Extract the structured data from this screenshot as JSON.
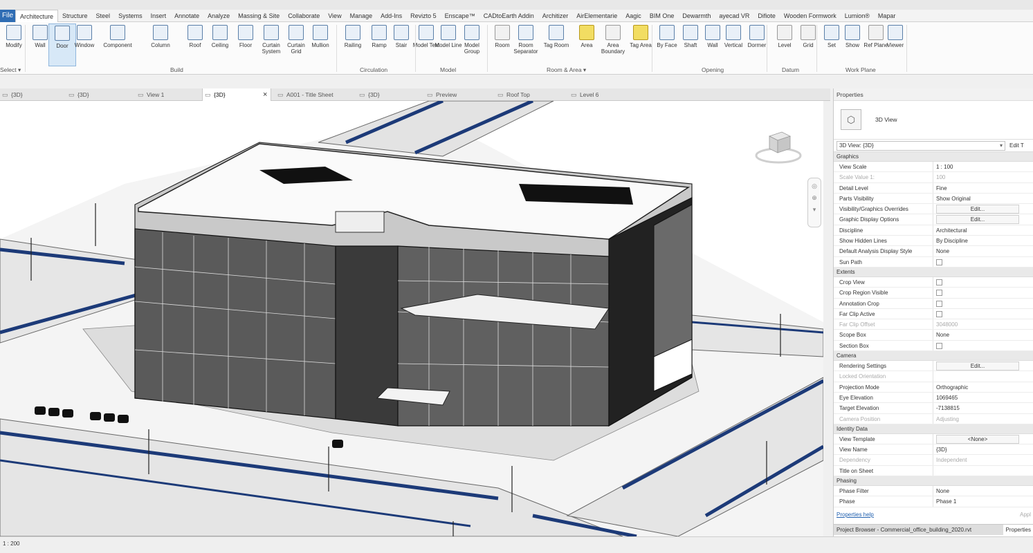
{
  "menu": {
    "file_label": "File",
    "tabs": [
      "Architecture",
      "Structure",
      "Steel",
      "Systems",
      "Insert",
      "Annotate",
      "Analyze",
      "Massing & Site",
      "Collaborate",
      "View",
      "Manage",
      "Add-Ins",
      "Revizto 5",
      "Enscape™",
      "CADtoEarth Addin",
      "Architizer",
      "AirElementarie",
      "Aagic",
      "BIM One",
      "Dewarmth",
      "ayecad VR",
      "Difiote",
      "Wooden Formwork",
      "Lumion®",
      "Mapar"
    ],
    "active_tab": "Architecture"
  },
  "ribbon": {
    "tools": [
      {
        "label": "Modify",
        "icon": "cursor-icon"
      },
      {
        "label": "Wall",
        "icon": "wall-icon"
      },
      {
        "label": "Door",
        "icon": "door-icon"
      },
      {
        "label": "Window",
        "icon": "window-icon"
      },
      {
        "label": "Component",
        "icon": "component-icon"
      },
      {
        "label": "Column",
        "icon": "column-icon"
      },
      {
        "label": "Roof",
        "icon": "roof-icon"
      },
      {
        "label": "Ceiling",
        "icon": "ceiling-icon"
      },
      {
        "label": "Floor",
        "icon": "floor-icon"
      },
      {
        "label": "Curtain System",
        "icon": "curtain-system-icon"
      },
      {
        "label": "Curtain Grid",
        "icon": "curtain-grid-icon"
      },
      {
        "label": "Mullion",
        "icon": "mullion-icon"
      },
      {
        "label": "Railing",
        "icon": "railing-icon"
      },
      {
        "label": "Ramp",
        "icon": "ramp-icon"
      },
      {
        "label": "Stair",
        "icon": "stair-icon"
      },
      {
        "label": "Model Text",
        "icon": "model-text-icon"
      },
      {
        "label": "Model Line",
        "icon": "model-line-icon"
      },
      {
        "label": "Model Group",
        "icon": "model-group-icon"
      },
      {
        "label": "Room",
        "icon": "room-icon"
      },
      {
        "label": "Room Separator",
        "icon": "room-separator-icon"
      },
      {
        "label": "Tag Room",
        "icon": "tag-room-icon"
      },
      {
        "label": "Area",
        "icon": "area-icon"
      },
      {
        "label": "Area Boundary",
        "icon": "area-boundary-icon"
      },
      {
        "label": "Tag Area",
        "icon": "tag-area-icon"
      },
      {
        "label": "By Face",
        "icon": "by-face-icon"
      },
      {
        "label": "Shaft",
        "icon": "shaft-icon"
      },
      {
        "label": "Wall",
        "icon": "wall-opening-icon"
      },
      {
        "label": "Vertical",
        "icon": "vertical-icon"
      },
      {
        "label": "Dormer",
        "icon": "dormer-icon"
      },
      {
        "label": "Level",
        "icon": "level-icon"
      },
      {
        "label": "Grid",
        "icon": "grid-icon"
      },
      {
        "label": "Set",
        "icon": "set-icon"
      },
      {
        "label": "Show",
        "icon": "show-icon"
      },
      {
        "label": "Ref Plane",
        "icon": "ref-plane-icon"
      },
      {
        "label": "Viewer",
        "icon": "viewer-icon"
      }
    ],
    "panels": [
      "Select ▾",
      "Build",
      "Circulation",
      "Model",
      "Room & Area ▾",
      "Opening",
      "Datum",
      "Work Plane"
    ]
  },
  "view_tabs": [
    {
      "label": "{3D}",
      "active": false
    },
    {
      "label": "{3D}",
      "active": false
    },
    {
      "label": "View 1",
      "active": false
    },
    {
      "label": "{3D}",
      "active": true
    },
    {
      "label": "A001 - Title Sheet",
      "active": false
    },
    {
      "label": "{3D}",
      "active": false
    },
    {
      "label": "Preview",
      "active": false
    },
    {
      "label": "Roof Top",
      "active": false
    },
    {
      "label": "Level 6",
      "active": false
    }
  ],
  "properties": {
    "title": "Properties",
    "type_name": "3D View",
    "selector": "3D View: {3D}",
    "edit_type": "Edit T",
    "groups": [
      {
        "name": "Graphics",
        "rows": [
          {
            "name": "View Scale",
            "value": "1 : 100",
            "kind": "field"
          },
          {
            "name": "Scale Value    1:",
            "value": "100",
            "kind": "dim"
          },
          {
            "name": "Detail Level",
            "value": "Fine",
            "kind": "text"
          },
          {
            "name": "Parts Visibility",
            "value": "Show Original",
            "kind": "text"
          },
          {
            "name": "Visibility/Graphics Overrides",
            "value": "Edit...",
            "kind": "button"
          },
          {
            "name": "Graphic Display Options",
            "value": "Edit...",
            "kind": "button"
          },
          {
            "name": "Discipline",
            "value": "Architectural",
            "kind": "text"
          },
          {
            "name": "Show Hidden Lines",
            "value": "By Discipline",
            "kind": "text"
          },
          {
            "name": "Default Analysis Display Style",
            "value": "None",
            "kind": "text"
          },
          {
            "name": "Sun Path",
            "value": "",
            "kind": "check"
          }
        ]
      },
      {
        "name": "Extents",
        "rows": [
          {
            "name": "Crop View",
            "value": "",
            "kind": "check"
          },
          {
            "name": "Crop Region Visible",
            "value": "",
            "kind": "check"
          },
          {
            "name": "Annotation Crop",
            "value": "",
            "kind": "check"
          },
          {
            "name": "Far Clip Active",
            "value": "",
            "kind": "check"
          },
          {
            "name": "Far Clip Offset",
            "value": "3048000",
            "kind": "dim"
          },
          {
            "name": "Scope Box",
            "value": "None",
            "kind": "text"
          },
          {
            "name": "Section Box",
            "value": "",
            "kind": "check"
          }
        ]
      },
      {
        "name": "Camera",
        "rows": [
          {
            "name": "Rendering Settings",
            "value": "Edit...",
            "kind": "button"
          },
          {
            "name": "Locked Orientation",
            "value": "",
            "kind": "dim"
          },
          {
            "name": "Projection Mode",
            "value": "Orthographic",
            "kind": "text"
          },
          {
            "name": "Eye Elevation",
            "value": "1069465",
            "kind": "text"
          },
          {
            "name": "Target Elevation",
            "value": "-7138815",
            "kind": "text"
          },
          {
            "name": "Camera Position",
            "value": "Adjusting",
            "kind": "dim"
          }
        ]
      },
      {
        "name": "Identity Data",
        "rows": [
          {
            "name": "View Template",
            "value": "<None>",
            "kind": "button"
          },
          {
            "name": "View Name",
            "value": "{3D}",
            "kind": "text"
          },
          {
            "name": "Dependency",
            "value": "Independent",
            "kind": "dim"
          },
          {
            "name": "Title on Sheet",
            "value": "",
            "kind": "text"
          }
        ]
      },
      {
        "name": "Phasing",
        "rows": [
          {
            "name": "Phase Filter",
            "value": "None",
            "kind": "text"
          },
          {
            "name": "Phase",
            "value": "Phase 1",
            "kind": "text"
          }
        ]
      }
    ],
    "help_link": "Properties help",
    "apply": "Appl",
    "bottom_tabs": [
      "Project Browser - Commercial_office_building_2020.rvt",
      "Properties"
    ]
  },
  "status": {
    "scale": "1 : 200"
  },
  "colors": {
    "accent": "#2f6db4",
    "road_stripe": "#1c3a78"
  }
}
